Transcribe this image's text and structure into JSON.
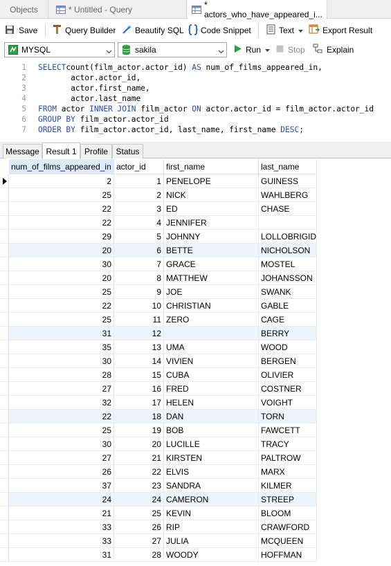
{
  "tabs": {
    "objects": "Objects",
    "untitled": "* Untitled - Query",
    "active": "* actors_who_have_appeared_i..."
  },
  "toolbar": {
    "save": "Save",
    "query_builder": "Query Builder",
    "beautify": "Beautify SQL",
    "snippet": "Code Snippet",
    "text": "Text",
    "export": "Export Result"
  },
  "connection": {
    "server": "MYSQL",
    "database": "sakila",
    "run": "Run",
    "stop": "Stop",
    "explain": "Explain"
  },
  "editor": {
    "lines": [
      {
        "n": "1",
        "parts": [
          [
            "kw",
            "SELECT"
          ],
          [
            "",
            "count(film_actor.actor_id) "
          ],
          [
            "kw",
            "AS"
          ],
          [
            "",
            " num_of_films_appeared_in,"
          ]
        ]
      },
      {
        "n": "2",
        "parts": [
          [
            "",
            "       actor.actor_id,"
          ]
        ]
      },
      {
        "n": "3",
        "parts": [
          [
            "",
            "       actor.first_name,"
          ]
        ]
      },
      {
        "n": "4",
        "parts": [
          [
            "",
            "       actor.last_name"
          ]
        ]
      },
      {
        "n": "5",
        "parts": [
          [
            "kw",
            "FROM"
          ],
          [
            "",
            " actor "
          ],
          [
            "kw",
            "INNER JOIN"
          ],
          [
            "",
            " film_actor "
          ],
          [
            "kw",
            "ON"
          ],
          [
            "",
            " actor.actor_id = film_actor.actor_id"
          ]
        ]
      },
      {
        "n": "6",
        "parts": [
          [
            "kw",
            "GROUP BY"
          ],
          [
            "",
            " film_actor.actor_id"
          ]
        ]
      },
      {
        "n": "7",
        "parts": [
          [
            "kw",
            "ORDER BY"
          ],
          [
            "",
            " film_actor.actor_id, last_name, first_name "
          ],
          [
            "kw",
            "DESC"
          ],
          [
            "",
            ";"
          ]
        ]
      }
    ]
  },
  "result_tabs": [
    "Message",
    "Result 1",
    "Profile",
    "Status"
  ],
  "grid": {
    "columns": [
      "num_of_films_appeared_in",
      "actor_id",
      "first_name",
      "last_name"
    ],
    "rows": [
      [
        "2",
        "1",
        "PENELOPE",
        "GUINESS"
      ],
      [
        "25",
        "2",
        "NICK",
        "WAHLBERG"
      ],
      [
        "22",
        "3",
        "ED",
        "CHASE"
      ],
      [
        "22",
        "4",
        "JENNIFER",
        ""
      ],
      [
        "29",
        "5",
        "JOHNNY",
        "LOLLOBRIGIDA"
      ],
      [
        "20",
        "6",
        "BETTE",
        "NICHOLSON"
      ],
      [
        "30",
        "7",
        "GRACE",
        "MOSTEL"
      ],
      [
        "20",
        "8",
        "MATTHEW",
        "JOHANSSON"
      ],
      [
        "25",
        "9",
        "JOE",
        "SWANK"
      ],
      [
        "22",
        "10",
        "CHRISTIAN",
        "GABLE"
      ],
      [
        "25",
        "11",
        "ZERO",
        "CAGE"
      ],
      [
        "31",
        "12",
        "",
        "BERRY"
      ],
      [
        "35",
        "13",
        "UMA",
        "WOOD"
      ],
      [
        "30",
        "14",
        "VIVIEN",
        "BERGEN"
      ],
      [
        "28",
        "15",
        "CUBA",
        "OLIVIER"
      ],
      [
        "27",
        "16",
        "FRED",
        "COSTNER"
      ],
      [
        "32",
        "17",
        "HELEN",
        "VOIGHT"
      ],
      [
        "22",
        "18",
        "DAN",
        "TORN"
      ],
      [
        "25",
        "19",
        "BOB",
        "FAWCETT"
      ],
      [
        "30",
        "20",
        "LUCILLE",
        "TRACY"
      ],
      [
        "27",
        "21",
        "KIRSTEN",
        "PALTROW"
      ],
      [
        "26",
        "22",
        "ELVIS",
        "MARX"
      ],
      [
        "37",
        "23",
        "SANDRA",
        "KILMER"
      ],
      [
        "24",
        "24",
        "CAMERON",
        "STREEP"
      ],
      [
        "21",
        "25",
        "KEVIN",
        "BLOOM"
      ],
      [
        "33",
        "26",
        "RIP",
        "CRAWFORD"
      ],
      [
        "33",
        "27",
        "JULIA",
        "MCQUEEN"
      ],
      [
        "31",
        "28",
        "WOODY",
        "HOFFMAN"
      ]
    ]
  },
  "colors": {
    "keyword": "#2a4ab8",
    "row_highlight": "#edf3fb",
    "header_selected": "#dfe9f7"
  }
}
